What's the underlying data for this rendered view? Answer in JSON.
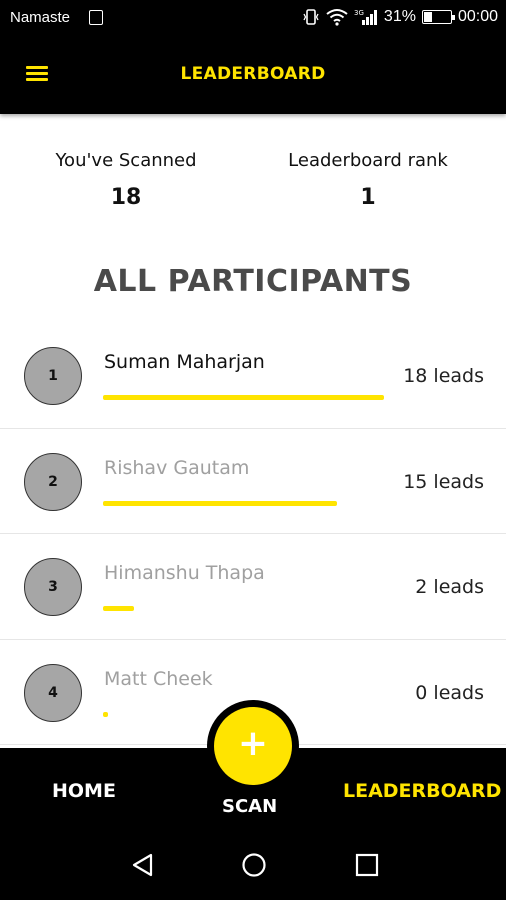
{
  "status_bar": {
    "carrier": "Namaste",
    "battery": "31%",
    "time": "00:00",
    "network": "3G"
  },
  "app_bar": {
    "title": "LEADERBOARD",
    "menu_icon": "hamburger-menu-icon"
  },
  "stats": {
    "scanned_label": "You've Scanned",
    "scanned_value": "18",
    "rank_label": "Leaderboard rank",
    "rank_value": "1"
  },
  "section_title": "ALL PARTICIPANTS",
  "participants": [
    {
      "rank": "1",
      "name": "Suman Maharjan",
      "leads": "18 leads",
      "progress": 1.0
    },
    {
      "rank": "2",
      "name": "Rishav Gautam",
      "leads": "15 leads",
      "progress": 0.833
    },
    {
      "rank": "3",
      "name": "Himanshu Thapa",
      "leads": "2 leads",
      "progress": 0.111
    },
    {
      "rank": "4",
      "name": "Matt Cheek",
      "leads": "0 leads",
      "progress": 0.0
    }
  ],
  "bottom_nav": {
    "home": "HOME",
    "scan": "SCAN",
    "leaderboard": "LEADERBOARD",
    "scan_icon": "plus-icon"
  },
  "colors": {
    "accent": "#ffe400",
    "bar_bg": "#000000",
    "rank_circle": "#a6a6a6"
  }
}
